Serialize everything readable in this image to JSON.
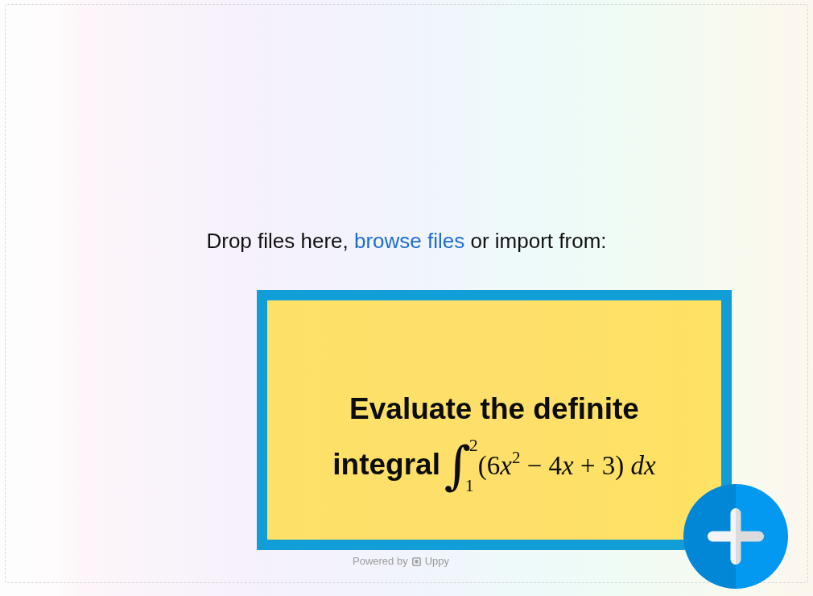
{
  "drop_zone": {
    "prompt_start": "Drop files here,",
    "browse_link": "browse files",
    "prompt_end": "or import from:",
    "footer": {
      "label": "Powered by",
      "brand": "Uppy"
    }
  },
  "question_card": {
    "text": "Evaluate the definite integral",
    "formula": {
      "sign": "∫",
      "lower_limit": "1",
      "upper_limit": "2",
      "integrand": "(6x$^{2}$ − 4x + 3) dx"
    }
  }
}
